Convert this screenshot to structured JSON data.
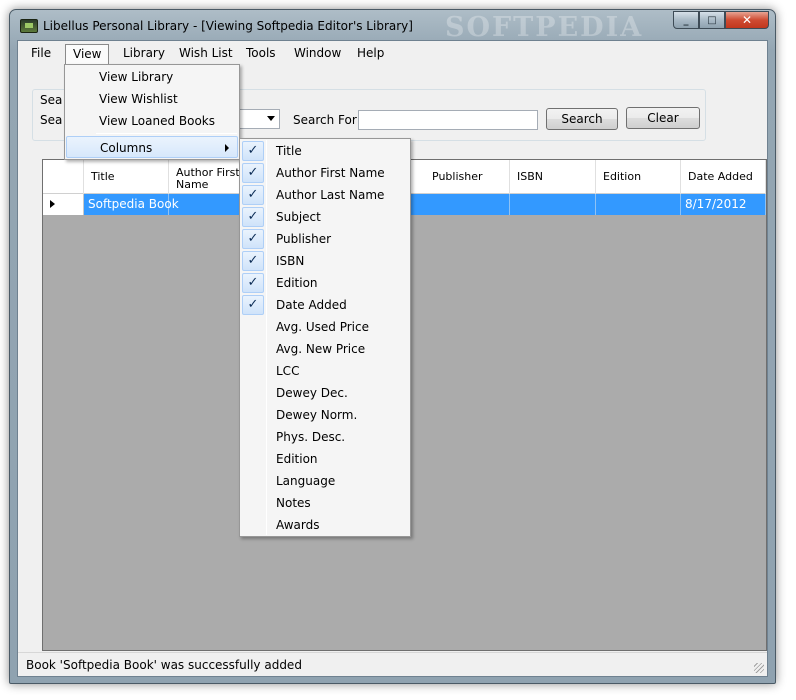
{
  "window": {
    "title": "Libellus Personal Library - [Viewing Softpedia Editor's Library]",
    "watermark": "SOFTPEDIA",
    "controls": {
      "minimize": "_",
      "maximize": "□",
      "close": "✕"
    }
  },
  "menubar": {
    "items": [
      "File",
      "View",
      "Library",
      "Wish List",
      "Tools",
      "Window",
      "Help"
    ],
    "active": "View"
  },
  "view_menu": {
    "items": [
      "View Library",
      "View Wishlist",
      "View Loaned Books",
      "Columns"
    ],
    "highlighted": "Columns"
  },
  "columns_menu": {
    "items": [
      {
        "label": "Title",
        "checked": true
      },
      {
        "label": "Author First Name",
        "checked": true
      },
      {
        "label": "Author Last Name",
        "checked": true
      },
      {
        "label": "Subject",
        "checked": true
      },
      {
        "label": "Publisher",
        "checked": true
      },
      {
        "label": "ISBN",
        "checked": true
      },
      {
        "label": "Edition",
        "checked": true
      },
      {
        "label": "Date Added",
        "checked": true
      },
      {
        "label": "Avg. Used Price",
        "checked": false
      },
      {
        "label": "Avg. New Price",
        "checked": false
      },
      {
        "label": "LCC",
        "checked": false
      },
      {
        "label": "Dewey Dec.",
        "checked": false
      },
      {
        "label": "Dewey Norm.",
        "checked": false
      },
      {
        "label": "Phys. Desc.",
        "checked": false
      },
      {
        "label": "Edition",
        "checked": false
      },
      {
        "label": "Language",
        "checked": false
      },
      {
        "label": "Notes",
        "checked": false
      },
      {
        "label": "Awards",
        "checked": false
      }
    ]
  },
  "search": {
    "line1_label": "Sea",
    "line2_label": "Sea",
    "search_for_label": "Search For:",
    "search_value": "",
    "search_button": "Search",
    "clear_button": "Clear"
  },
  "grid": {
    "columns": [
      "Title",
      "Author First Name",
      "Publisher",
      "ISBN",
      "Edition",
      "Date Added"
    ],
    "rows": [
      {
        "title": "Softpedia Book",
        "date_added": "8/17/2012"
      }
    ]
  },
  "status": {
    "message": "Book 'Softpedia Book' was successfully added"
  },
  "colors": {
    "selection": "#3399ff",
    "grid_background": "#ababab",
    "menu_highlight": "#d7e8fb"
  }
}
